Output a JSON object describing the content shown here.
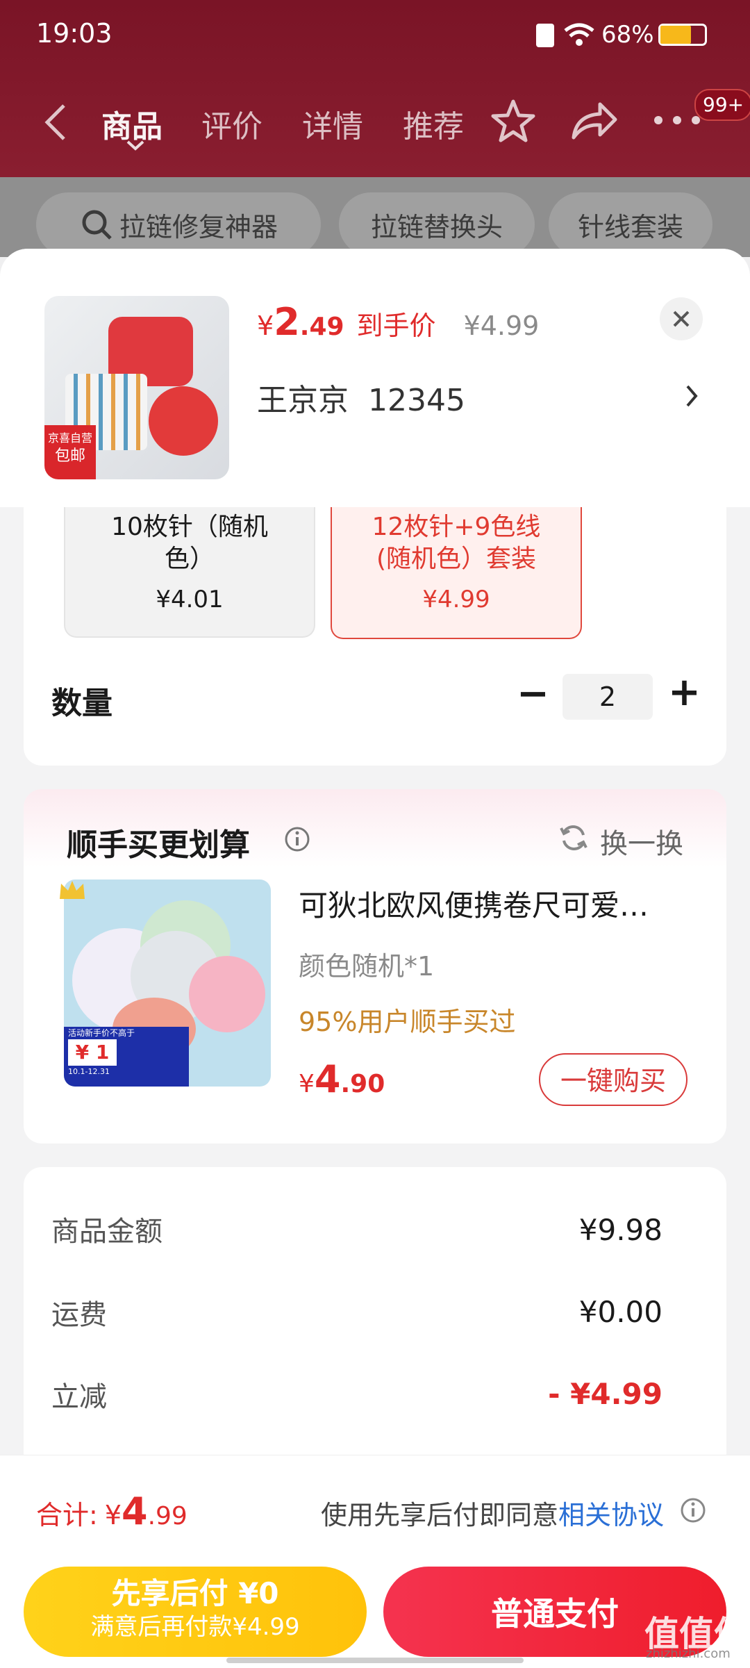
{
  "status_bar": {
    "time": "19:03",
    "battery": "68%"
  },
  "nav": {
    "tabs": [
      "商品",
      "评价",
      "详情",
      "推荐"
    ],
    "badge": "99+"
  },
  "search_chips": [
    "拉链修复神器",
    "拉链替换头",
    "针线套装"
  ],
  "sheet": {
    "price_symbol": "¥",
    "price_int": "2",
    "price_dec": ".49",
    "price_label": "到手价",
    "original_price": "¥4.99",
    "address": "王京京  12345",
    "thumb_badge_top": "京喜自营",
    "thumb_badge_bottom": "包邮"
  },
  "options": [
    {
      "line1": "10枚针（随机",
      "line2": "色）",
      "price": "¥4.01",
      "selected": false
    },
    {
      "line1": "12枚针+9色线",
      "line2": "(随机色）套装",
      "price": "¥4.99",
      "selected": true
    }
  ],
  "quantity": {
    "label": "数量",
    "value": "2",
    "minus": "−",
    "plus": "+"
  },
  "addon": {
    "title": "顺手买更划算",
    "refresh": "换一换",
    "product_title": "可狄北欧风便携卷尺可爱…",
    "spec": "颜色随机*1",
    "social": "95%用户顺手买过",
    "price_symbol": "¥",
    "price_int": "4",
    "price_dec": ".90",
    "buy_button": "一键购买",
    "img_text_promo": "活动新手价不高于",
    "img_text_price": "¥ 1",
    "img_text_date": "10.1-12.31"
  },
  "summary": [
    {
      "label": "商品金额",
      "value": "¥9.98",
      "highlight": false
    },
    {
      "label": "运费",
      "value": "¥0.00",
      "highlight": false
    },
    {
      "label": "立减",
      "value": "- ¥4.99",
      "highlight": true
    }
  ],
  "footer": {
    "total_label": "合计:",
    "total_symbol": "¥",
    "total_int": "4",
    "total_dec": ".99",
    "agreement_prefix": "使用先享后付即同意",
    "agreement_link": "相关协议"
  },
  "buttons": {
    "later_line1": "先享后付 ¥0",
    "later_line2": "满意后再付款¥4.99",
    "pay": "普通支付"
  },
  "watermark": "值值值",
  "watermark_url": "zhizhizhi.com",
  "colors": {
    "accent": "#e02b2b",
    "link": "#2a6fd6",
    "yellow": "#ffc90f",
    "social": "#c8862a"
  }
}
